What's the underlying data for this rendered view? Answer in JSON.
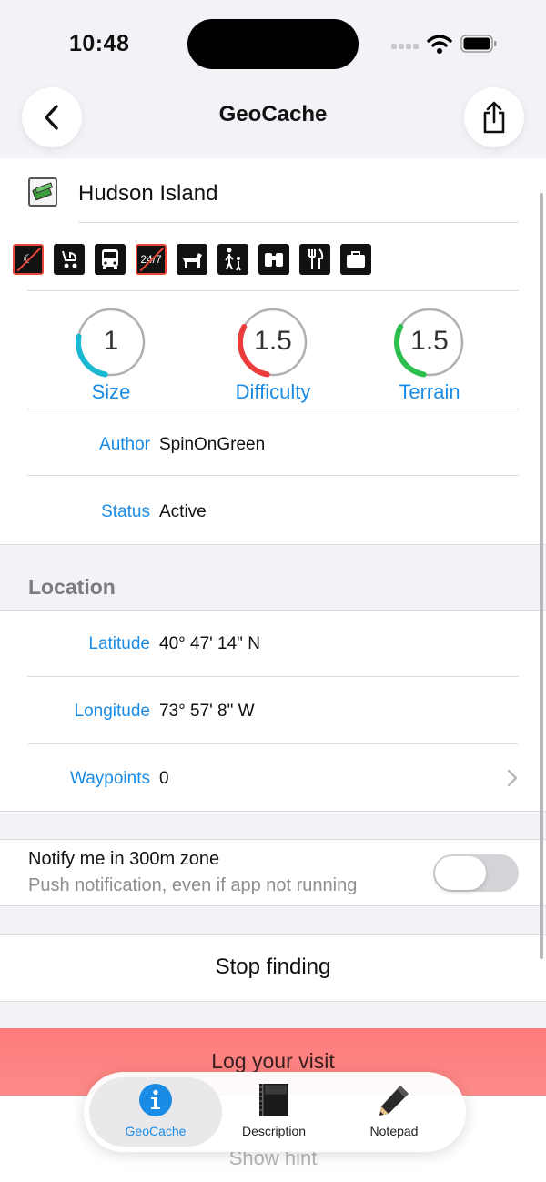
{
  "status_bar": {
    "time": "10:48"
  },
  "nav": {
    "title": "GeoCache",
    "back_icon": "chevron-left-icon",
    "share_icon": "share-icon"
  },
  "cache": {
    "name": "Hudson Island",
    "type_icon": "traditional-cache-icon",
    "attributes": [
      {
        "icon": "night-cache-icon",
        "label": "",
        "negated": true
      },
      {
        "icon": "stroller-icon",
        "label": "",
        "negated": false
      },
      {
        "icon": "bus-icon",
        "label": "",
        "negated": false
      },
      {
        "icon": "available-24-7-icon",
        "label": "24/7",
        "negated": true
      },
      {
        "icon": "dog-icon",
        "label": "",
        "negated": false
      },
      {
        "icon": "kids-icon",
        "label": "",
        "negated": false
      },
      {
        "icon": "scenic-view-icon",
        "label": "",
        "negated": false
      },
      {
        "icon": "food-icon",
        "label": "",
        "negated": false
      },
      {
        "icon": "briefcase-icon",
        "label": "",
        "negated": false
      }
    ]
  },
  "gauges": {
    "size": {
      "value": "1",
      "label": "Size",
      "fill": 0.25,
      "color": "#19b8d0"
    },
    "difficulty": {
      "value": "1.5",
      "label": "Difficulty",
      "fill": 0.3,
      "color": "#ec3b3b"
    },
    "terrain": {
      "value": "1.5",
      "label": "Terrain",
      "fill": 0.3,
      "color": "#2fbf4f"
    }
  },
  "details": {
    "author_label": "Author",
    "author_value": "SpinOnGreen",
    "status_label": "Status",
    "status_value": "Active"
  },
  "location": {
    "header": "Location",
    "latitude_label": "Latitude",
    "latitude_value": "40° 47' 14\" N",
    "longitude_label": "Longitude",
    "longitude_value": "73° 57' 8\" W",
    "waypoints_label": "Waypoints",
    "waypoints_value": "0"
  },
  "notify": {
    "title": "Notify me in 300m zone",
    "subtitle": "Push notification, even if app not running",
    "enabled": false
  },
  "actions": {
    "stop_finding": "Stop finding",
    "log_visit": "Log your visit",
    "show_hint": "Show hint"
  },
  "tabs": [
    {
      "label": "GeoCache",
      "icon": "info-icon",
      "active": true
    },
    {
      "label": "Description",
      "icon": "book-icon",
      "active": false
    },
    {
      "label": "Notepad",
      "icon": "pencil-icon",
      "active": false
    }
  ],
  "colors": {
    "accent": "#1a8ce6",
    "log_button": "#ff7b7b"
  }
}
